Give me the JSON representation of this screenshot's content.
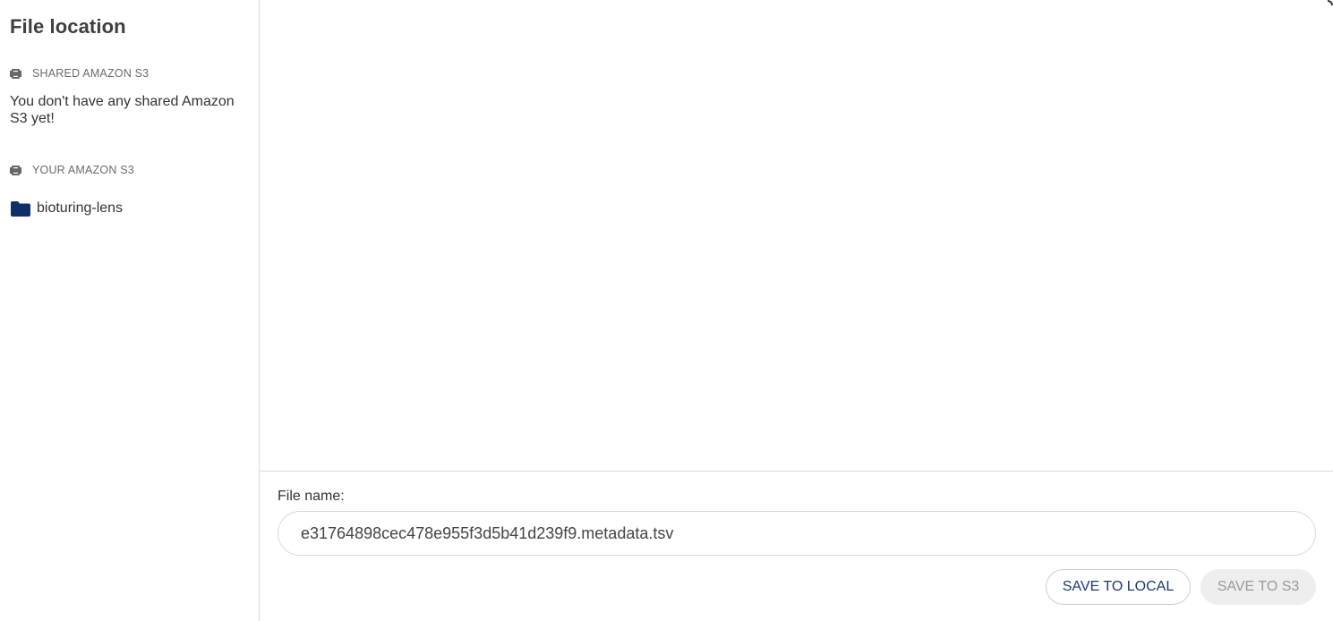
{
  "sidebar": {
    "title": "File location",
    "shared_section": {
      "label": "SHARED AMAZON S3",
      "icon": "bucket-icon",
      "empty_message": "You don't have any shared Amazon S3 yet!"
    },
    "your_section": {
      "label": "YOUR AMAZON S3",
      "icon": "bucket-icon",
      "items": [
        {
          "label": "bioturing-lens",
          "icon": "folder-icon"
        }
      ]
    }
  },
  "footer": {
    "file_name_label": "File name:",
    "file_name_value": "e31764898cec478e955f3d5b41d239f9.metadata.tsv",
    "save_local_label": "SAVE TO LOCAL",
    "save_s3_label": "SAVE TO S3"
  },
  "colors": {
    "folder": "#0f2f6b",
    "primary_text": "#1c3a72",
    "disabled_bg": "#eeeeee",
    "disabled_text": "#9a9a9a"
  }
}
